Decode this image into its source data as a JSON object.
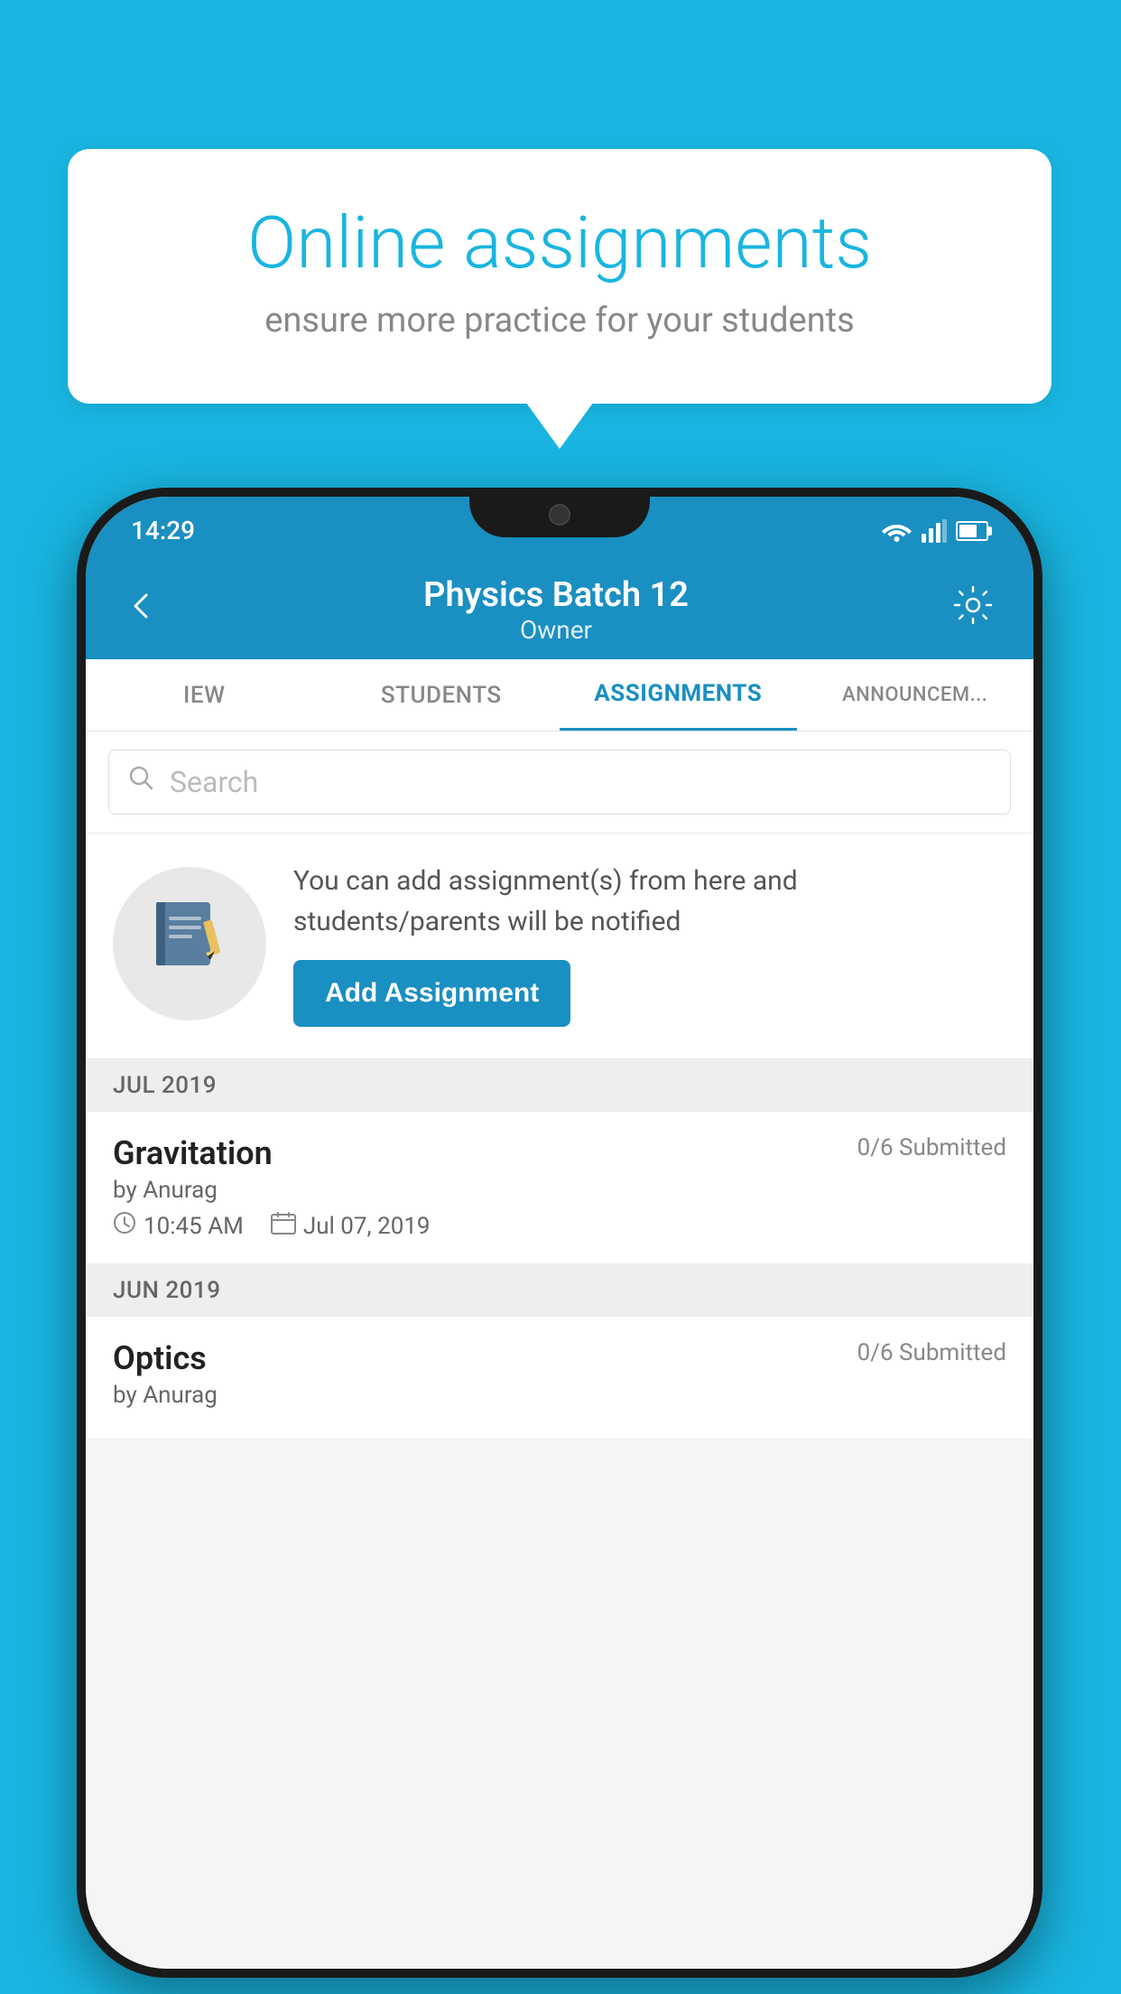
{
  "background": {
    "color": "#19b5e0"
  },
  "speech_bubble": {
    "title": "Online assignments",
    "subtitle": "ensure more practice for your students"
  },
  "status_bar": {
    "time": "14:29",
    "icons": [
      "wifi",
      "signal",
      "battery"
    ]
  },
  "app_header": {
    "title": "Physics Batch 12",
    "subtitle": "Owner",
    "back_label": "←",
    "settings_label": "⚙"
  },
  "tabs": [
    {
      "label": "IEW",
      "active": false
    },
    {
      "label": "STUDENTS",
      "active": false
    },
    {
      "label": "ASSIGNMENTS",
      "active": true
    },
    {
      "label": "ANNOUNCEM...",
      "active": false
    }
  ],
  "search": {
    "placeholder": "Search"
  },
  "info_card": {
    "text": "You can add assignment(s) from here and students/parents will be notified",
    "button_label": "Add Assignment",
    "icon": "📓"
  },
  "sections": [
    {
      "header": "JUL 2019",
      "assignments": [
        {
          "name": "Gravitation",
          "submitted": "0/6 Submitted",
          "author": "by Anurag",
          "time": "10:45 AM",
          "date": "Jul 07, 2019"
        }
      ]
    },
    {
      "header": "JUN 2019",
      "assignments": [
        {
          "name": "Optics",
          "submitted": "0/6 Submitted",
          "author": "by Anurag",
          "time": "",
          "date": ""
        }
      ]
    }
  ]
}
